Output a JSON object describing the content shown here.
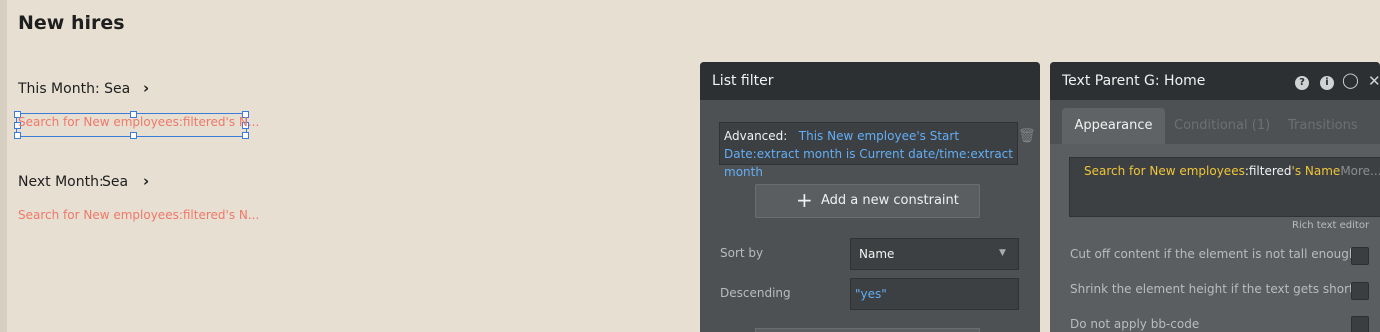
{
  "canvas": {
    "page_title": "New hires",
    "this_month_label": "This Month: Sea",
    "this_month_text": "Search for New employees:filtered's N...",
    "next_month_label": "Next Month:",
    "next_month_sea": "Sea",
    "next_month_text": "Search for New employees:filtered's N..."
  },
  "list_filter": {
    "title": "List filter",
    "advanced_label": "Advanced:",
    "advanced_expression": "This New employee's Start Date:extract month is Current date/time:extract month",
    "add_constraint_label": "Add a new constraint",
    "sort_by_label": "Sort by",
    "sort_by_value": "Name",
    "descending_label": "Descending",
    "descending_value": "\"yes\""
  },
  "text_panel": {
    "title": "Text Parent G: Home",
    "tabs": [
      {
        "label": "Appearance",
        "active": true
      },
      {
        "label": "Conditional (1)",
        "active": false
      },
      {
        "label": "Transitions",
        "active": false
      }
    ],
    "expr_part1": "Search for New employees",
    "expr_part2": ":filtered",
    "expr_part3": "'s Name",
    "expr_more": "More...",
    "rich_text_label": "Rich text editor",
    "options": [
      "Cut off content if the element is not tall enough",
      "Shrink the element height if the text gets shorter",
      "Do not apply bb-code"
    ]
  },
  "colors": {
    "canvas_bg": "#e6dfd2",
    "panel_bg": "#4e5153",
    "panel_header": "#2c3032",
    "dynamic_expr": "#f0c53a",
    "link_blue": "#63aef5",
    "placeholder_red": "#f0786a"
  }
}
